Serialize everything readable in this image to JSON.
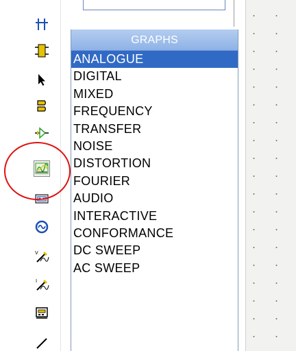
{
  "graphs_panel": {
    "header": "GRAPHS",
    "selected_index": 0,
    "items": [
      "ANALOGUE",
      "DIGITAL",
      "MIXED",
      "FREQUENCY",
      "TRANSFER",
      "NOISE",
      "DISTORTION",
      "FOURIER",
      "AUDIO",
      "INTERACTIVE",
      "CONFORMANCE",
      "DC SWEEP",
      "AC SWEEP"
    ]
  },
  "toolbar": {
    "tools": [
      "junction-dot-icon",
      "component-icon",
      "select-arrow-icon",
      "terminal-icon",
      "subcircuit-icon",
      "graph-mode-icon",
      "tape-recorder-icon",
      "generator-icon",
      "voltage-probe-icon",
      "current-probe-icon",
      "virtual-instrument-icon",
      "line-tool-icon"
    ],
    "active_tool": "graph-mode-icon"
  },
  "colors": {
    "selection": "#316ac5",
    "header_gradient_top": "#b5cdf0",
    "header_gradient_bottom": "#8eb2e6",
    "highlight_circle": "#e01010",
    "icon_green": "#2ea02e",
    "icon_yellow": "#e6c200",
    "icon_blue": "#1a4fb5"
  }
}
